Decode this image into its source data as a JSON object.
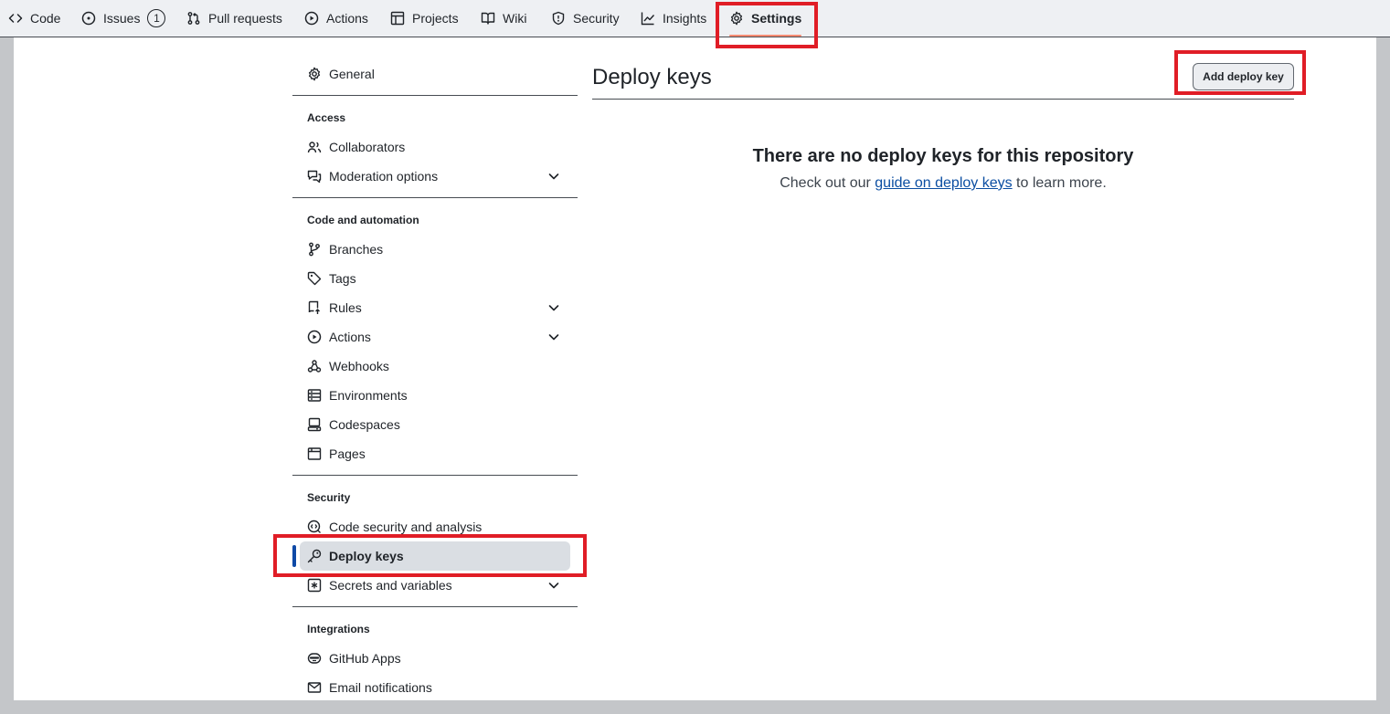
{
  "nav": {
    "tabs": [
      {
        "label": "Code",
        "icon": "code-icon"
      },
      {
        "label": "Issues",
        "icon": "issue-opened-icon",
        "count": "1"
      },
      {
        "label": "Pull requests",
        "icon": "git-pull-request-icon"
      },
      {
        "label": "Actions",
        "icon": "play-icon"
      },
      {
        "label": "Projects",
        "icon": "table-icon"
      },
      {
        "label": "Wiki",
        "icon": "book-icon"
      },
      {
        "label": "Security",
        "icon": "shield-icon"
      },
      {
        "label": "Insights",
        "icon": "graph-icon"
      },
      {
        "label": "Settings",
        "icon": "gear-icon",
        "active": true
      }
    ]
  },
  "sidebar": {
    "general": "General",
    "sections": [
      {
        "heading": "Access",
        "items": [
          "Collaborators",
          "Moderation options"
        ]
      },
      {
        "heading": "Code and automation",
        "items": [
          "Branches",
          "Tags",
          "Rules",
          "Actions",
          "Webhooks",
          "Environments",
          "Codespaces",
          "Pages"
        ]
      },
      {
        "heading": "Security",
        "items": [
          "Code security and analysis",
          "Deploy keys",
          "Secrets and variables"
        ]
      },
      {
        "heading": "Integrations",
        "items": [
          "GitHub Apps",
          "Email notifications"
        ]
      }
    ],
    "active_item": "Deploy keys"
  },
  "main": {
    "title": "Deploy keys",
    "add_button": "Add deploy key",
    "blankslate": {
      "heading": "There are no deploy keys for this repository",
      "text_before": "Check out our ",
      "link": "guide on deploy keys",
      "text_after": " to learn more."
    }
  },
  "colors": {
    "accent": "#0e49a6",
    "highlight": "#e01d26",
    "link": "#0b4ea2"
  }
}
